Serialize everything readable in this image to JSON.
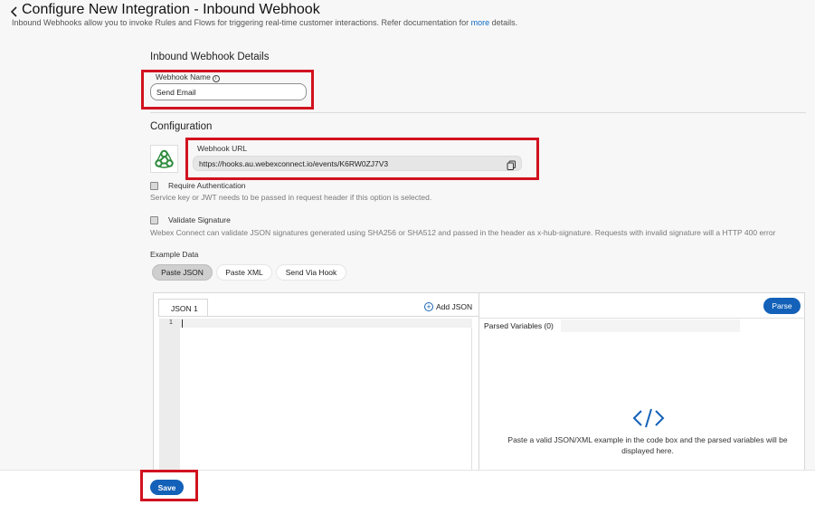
{
  "header": {
    "title": "Configure New Integration - Inbound Webhook",
    "subtitle_prefix": "Inbound Webhooks allow you to invoke Rules and Flows for triggering real-time customer interactions. Refer documentation for ",
    "subtitle_link": "more",
    "subtitle_suffix": " details."
  },
  "details": {
    "section_title": "Inbound Webhook Details",
    "name_label": "Webhook Name",
    "name_info_icon": "i",
    "name_value": "Send Email"
  },
  "configuration": {
    "section_title": "Configuration",
    "url_label": "Webhook URL",
    "url_value": "https://hooks.au.webexconnect.io/events/K6RW0ZJ7V3",
    "require_auth_label": "Require Authentication",
    "require_auth_help": "Service key or JWT needs to be passed in request header if this option is selected.",
    "validate_sig_label": "Validate Signature",
    "validate_sig_help": "Webex Connect can validate JSON signatures generated using SHA256 or SHA512 and passed in the header as x-hub-signature. Requests with invalid signature will a HTTP 400 error"
  },
  "example": {
    "label": "Example Data",
    "tabs": [
      "Paste JSON",
      "Paste XML",
      "Send Via Hook"
    ],
    "active_tab": "Paste JSON",
    "editor_tab": "JSON 1",
    "add_json": "Add JSON",
    "line_number": "1",
    "parse_button": "Parse",
    "parsed_label": "Parsed Variables (0)",
    "empty_message": "Paste a valid JSON/XML example in the code box and the parsed variables will be displayed here."
  },
  "footer": {
    "save_button": "Save"
  },
  "colors": {
    "accent": "#1361b8",
    "highlight": "#d1121f",
    "webhook_logo": "#2e8b3d"
  },
  "icons": {
    "back": "chevron-left-icon",
    "copy": "copy-icon",
    "webhook": "webhook-logo-icon",
    "code": "code-brackets-icon",
    "add": "plus-circle-icon"
  }
}
